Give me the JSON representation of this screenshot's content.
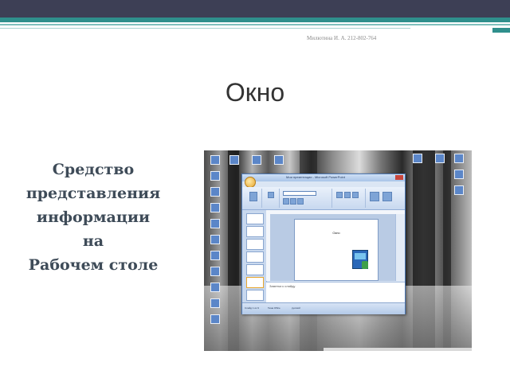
{
  "header": {
    "author": "Милютина И. А. 212-802-764"
  },
  "slide": {
    "title": "Окно",
    "description_lines": [
      "Средство",
      "представления",
      "информации",
      "на",
      "Рабочем столе"
    ]
  },
  "screenshot": {
    "window_title": "Мои презентации - Microsoft PowerPoint",
    "ribbon_tabs": [
      "Главная",
      "Вставка",
      "Дизайн",
      "Анимация",
      "Показ слайдов",
      "Рецензирование",
      "Вид"
    ],
    "slide_text": "Окно",
    "notes_placeholder": "Заметки к слайду",
    "status_slide": "Слайд 1 из 9",
    "status_theme": "Тема Office",
    "status_lang": "русский"
  },
  "colors": {
    "top_bar": "#3d3f55",
    "accent_teal": "#2f8f8c",
    "title_text": "#333333",
    "description_text": "#3e4b58"
  }
}
